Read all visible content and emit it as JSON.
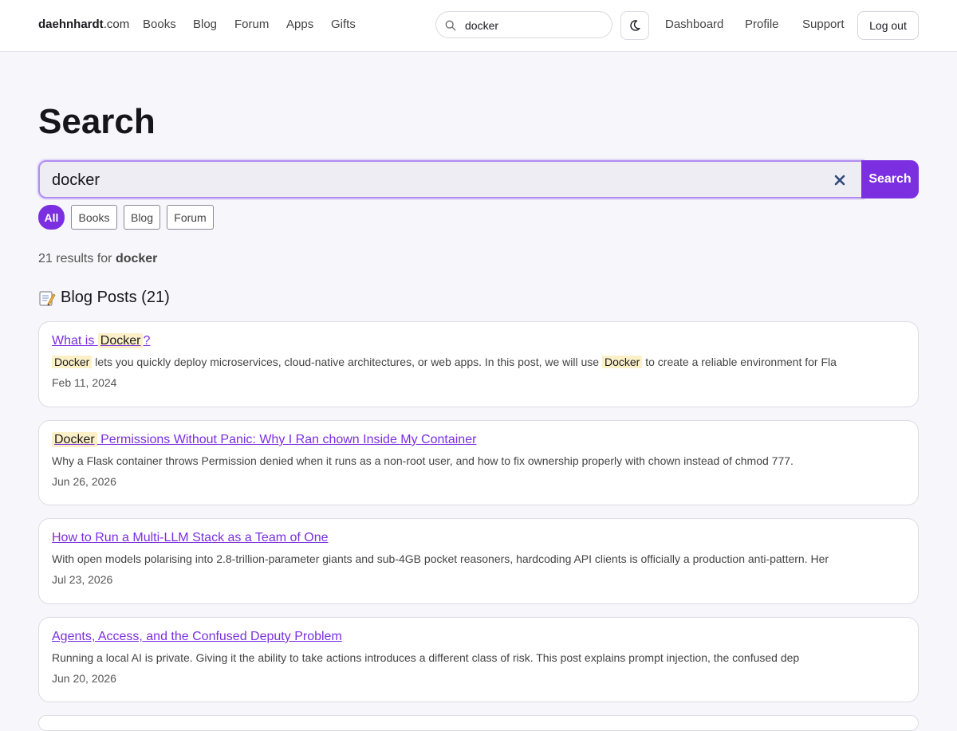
{
  "header": {
    "brand_bold": "daehnhardt",
    "brand_tld": ".com",
    "nav": [
      "Books",
      "Blog",
      "Forum",
      "Apps",
      "Gifts"
    ],
    "search_value": "docker",
    "right_nav": [
      "Dashboard",
      "Profile",
      "Support"
    ],
    "logout_label": "Log out"
  },
  "main": {
    "title": "Search",
    "search_value": "docker",
    "search_button": "Search",
    "filters": [
      "All",
      "Books",
      "Blog",
      "Forum"
    ],
    "active_filter": "All",
    "results_count_prefix": "21 results for ",
    "query": "docker",
    "section_heading": "Blog Posts (21)"
  },
  "results": [
    {
      "title_parts": [
        "What is ",
        "Docker",
        "?"
      ],
      "excerpt_parts": [
        "",
        "Docker",
        " lets you quickly deploy microservices, cloud-native architectures, or web apps. In this post, we will use ",
        "Docker",
        " to create a reliable environment for Fla"
      ],
      "date": "Feb 11, 2024"
    },
    {
      "title_parts": [
        "",
        "Docker",
        " Permissions Without Panic: Why I Ran chown Inside My Container"
      ],
      "excerpt_parts": [
        "Why a Flask container throws Permission denied when it runs as a non-root user, and how to fix ownership properly with chown instead of chmod 777."
      ],
      "date": "Jun 26, 2026"
    },
    {
      "title_parts": [
        "How to Run a Multi-LLM Stack as a Team of One"
      ],
      "excerpt_parts": [
        "With open models polarising into 2.8-trillion-parameter giants and sub-4GB pocket reasoners, hardcoding API clients is officially a production anti-pattern. Her"
      ],
      "date": "Jul 23, 2026"
    },
    {
      "title_parts": [
        "Agents, Access, and the Confused Deputy Problem"
      ],
      "excerpt_parts": [
        "Running a local AI is private. Giving it the ability to take actions introduces a different class of risk. This post explains prompt injection, the confused dep"
      ],
      "date": "Jun 20, 2026"
    }
  ],
  "colors": {
    "accent": "#7b2fe0",
    "highlight": "#fcf0c8",
    "background": "#f6f6fb"
  }
}
